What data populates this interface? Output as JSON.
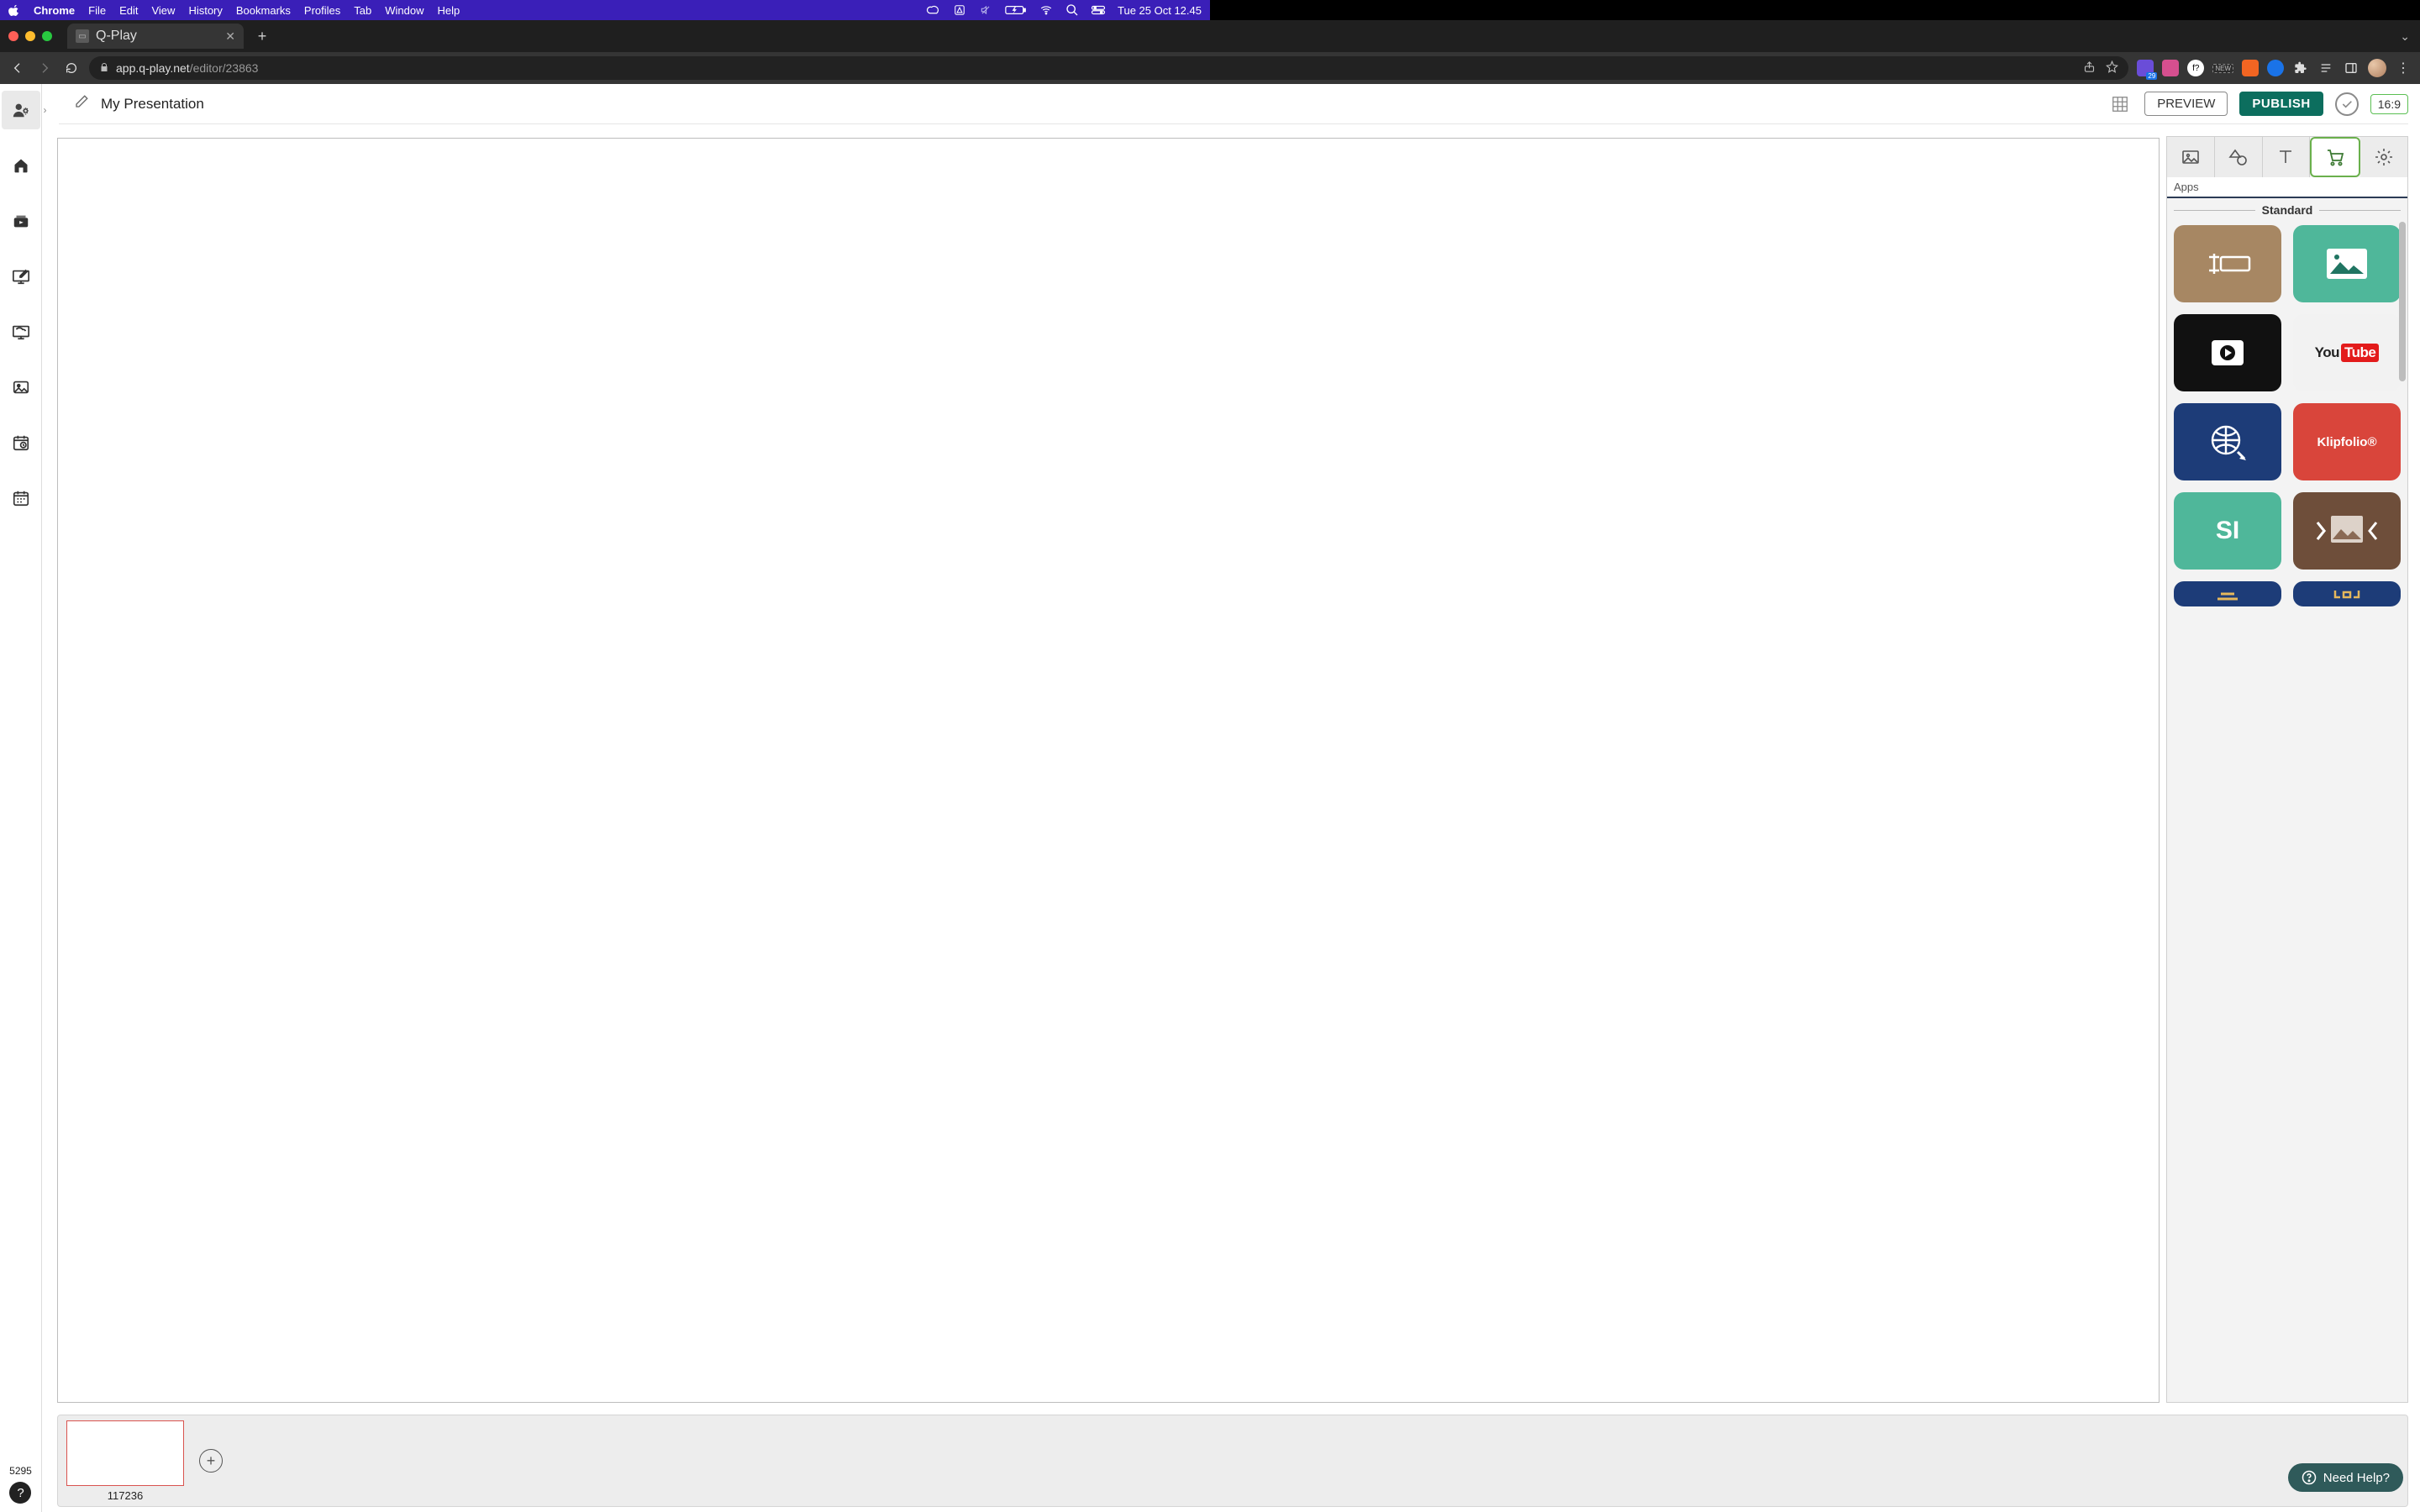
{
  "mac_menu": {
    "app": "Chrome",
    "items": [
      "File",
      "Edit",
      "View",
      "History",
      "Bookmarks",
      "Profiles",
      "Tab",
      "Window",
      "Help"
    ],
    "clock": "Tue 25 Oct  12.45"
  },
  "browser": {
    "tab_title": "Q-Play",
    "url_host": "app.q-play.net",
    "url_path": "/editor/23863",
    "ext_new_label": "NEW",
    "ext_badge": "29"
  },
  "docbar": {
    "title": "My Presentation",
    "preview": "PREVIEW",
    "publish": "PUBLISH",
    "ratio": "16:9"
  },
  "leftrail": {
    "counter": "5295"
  },
  "rightpanel": {
    "subhead": "Apps",
    "section": "Standard",
    "tiles": {
      "youtube_you": "You",
      "youtube_tube": "Tube",
      "klipfolio": "Klipfolio®",
      "si": "SI"
    }
  },
  "tray": {
    "slide_id": "117236"
  },
  "need_help": "Need Help?"
}
